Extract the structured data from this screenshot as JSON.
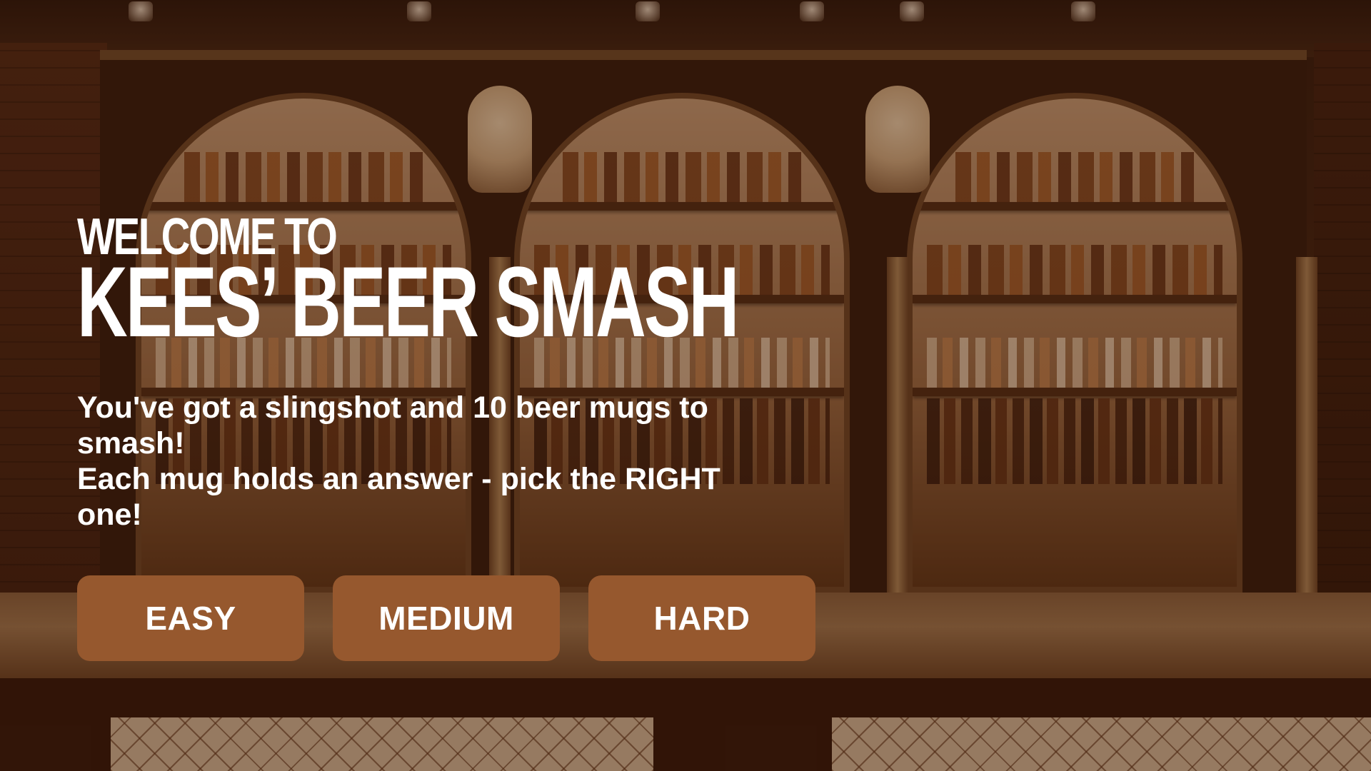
{
  "intro": {
    "welcome_line": "WELCOME TO",
    "game_title": "KEES’ BEER SMASH",
    "description_line_1": "You've got a slingshot and 10 beer mugs to smash!",
    "description_line_2": "Each mug holds an answer - pick the RIGHT one!"
  },
  "difficulty": {
    "options": [
      {
        "label": "EASY"
      },
      {
        "label": "MEDIUM"
      },
      {
        "label": "HARD"
      }
    ]
  },
  "colors": {
    "button_background": "#96582e",
    "text": "#ffffff",
    "background_tint": "#3c1908"
  }
}
